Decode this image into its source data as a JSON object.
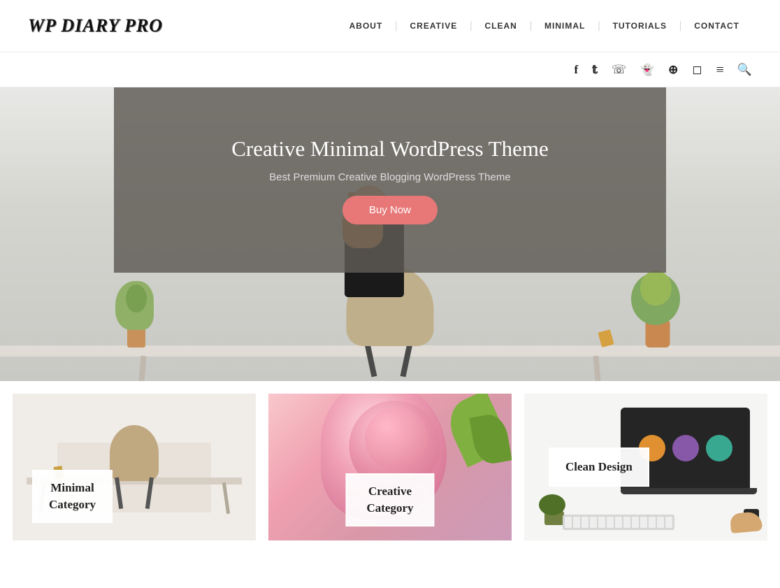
{
  "header": {
    "logo": "WP DIARY PRO",
    "nav": [
      {
        "label": "ABOUT",
        "id": "about"
      },
      {
        "label": "CREATIVE",
        "id": "creative"
      },
      {
        "label": "CLEAN",
        "id": "clean"
      },
      {
        "label": "MINIMAL",
        "id": "minimal"
      },
      {
        "label": "TUTORIALS",
        "id": "tutorials"
      },
      {
        "label": "CONTACT",
        "id": "contact"
      }
    ]
  },
  "social": {
    "icons": [
      {
        "name": "facebook-icon",
        "symbol": "f"
      },
      {
        "name": "twitter-icon",
        "symbol": "t"
      },
      {
        "name": "whatsapp-icon",
        "symbol": "w"
      },
      {
        "name": "snapchat-icon",
        "symbol": "s"
      },
      {
        "name": "reddit-icon",
        "symbol": "r"
      },
      {
        "name": "instagram-icon",
        "symbol": "i"
      },
      {
        "name": "menu-icon",
        "symbol": "≡"
      },
      {
        "name": "search-icon",
        "symbol": "🔍"
      }
    ]
  },
  "hero": {
    "title": "Creative Minimal WordPress Theme",
    "subtitle": "Best Premium Creative Blogging WordPress Theme",
    "button_label": "Buy Now"
  },
  "categories": [
    {
      "id": "minimal",
      "label_line1": "Minimal",
      "label_line2": "Category"
    },
    {
      "id": "creative",
      "label_line1": "Creative",
      "label_line2": "Category"
    },
    {
      "id": "clean",
      "label_line1": "Clean Design",
      "label_line2": ""
    }
  ]
}
